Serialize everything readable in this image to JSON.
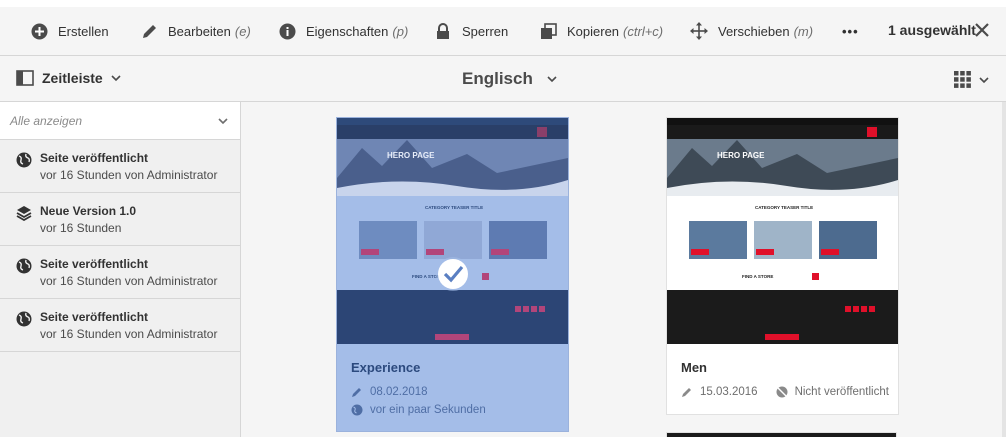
{
  "actionbar": {
    "create": "Erstellen",
    "edit": "Bearbeiten",
    "edit_hint": "(e)",
    "properties": "Eigenschaften",
    "properties_hint": "(p)",
    "lock": "Sperren",
    "copy": "Kopieren",
    "copy_hint": "(ctrl+c)",
    "move": "Verschieben",
    "move_hint": "(m)",
    "more": "•••",
    "selected": "1 ausgewählt"
  },
  "subbar": {
    "rail_label": "Zeitleiste",
    "title": "Englisch"
  },
  "rail": {
    "filter": "Alle anzeigen",
    "items": [
      {
        "icon": "globe-icon",
        "title": "Seite veröffentlicht",
        "detail": "vor 16 Stunden von Administrator"
      },
      {
        "icon": "layers-icon",
        "title": "Neue Version 1.0",
        "detail": "vor 16 Stunden"
      },
      {
        "icon": "globe-icon",
        "title": "Seite veröffentlicht",
        "detail": "vor 16 Stunden von Administrator"
      },
      {
        "icon": "globe-icon",
        "title": "Seite veröffentlicht",
        "detail": "vor 16 Stunden von Administrator"
      }
    ]
  },
  "cards": [
    {
      "title": "Experience",
      "selected": true,
      "modified": "08.02.2018",
      "published": "vor ein paar Sekunden",
      "thumb": {
        "hero": "HERO PAGE",
        "teaser": "CATEGORY TEASER TITLE",
        "store": "FIND A STORE"
      }
    },
    {
      "title": "Men",
      "selected": false,
      "modified": "15.03.2016",
      "published": "Nicht veröffentlicht",
      "thumb": {
        "hero": "HERO PAGE",
        "teaser": "CATEGORY TEASER TITLE",
        "store": "FIND A STORE"
      }
    }
  ],
  "colors": {
    "selection": "#a4bde8",
    "accent_red": "#e0102a",
    "toolbar_bg": "#f5f5f5"
  }
}
